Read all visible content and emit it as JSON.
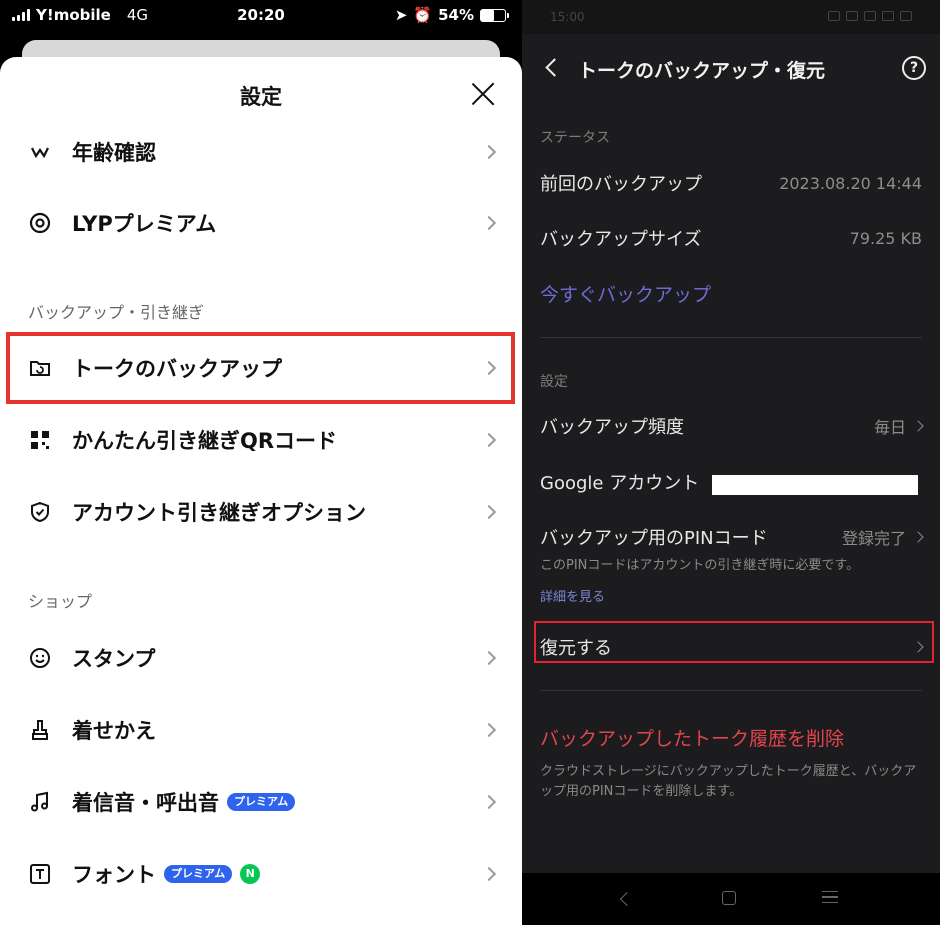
{
  "left": {
    "status": {
      "carrier": "Y!mobile",
      "network": "4G",
      "time": "20:20",
      "battery": "54%",
      "battery_level": 0.54
    },
    "sheet_title": "設定",
    "rows_top": [
      {
        "label": "年齢確認",
        "icon": "id-check-icon"
      },
      {
        "label": "LYPプレミアム",
        "icon": "premium-icon"
      }
    ],
    "section_backup": "バックアップ・引き継ぎ",
    "rows_backup": [
      {
        "label": "トークのバックアップ",
        "icon": "folder-backup-icon"
      },
      {
        "label": "かんたん引き継ぎQRコード",
        "icon": "qr-code-icon"
      },
      {
        "label": "アカウント引き継ぎオプション",
        "icon": "shield-icon"
      }
    ],
    "section_shop": "ショップ",
    "rows_shop": [
      {
        "label": "スタンプ",
        "icon": "smiley-icon"
      },
      {
        "label": "着せかえ",
        "icon": "brush-icon"
      },
      {
        "label": "着信音・呼出音",
        "icon": "music-note-icon",
        "badge": "プレミアム"
      },
      {
        "label": "フォント",
        "icon": "font-icon",
        "badge": "プレミアム",
        "dot": "N"
      }
    ]
  },
  "right": {
    "status_time": "15:00",
    "title": "トークのバックアップ・復元",
    "help_label": "?",
    "section_status": "ステータス",
    "last_backup_label": "前回のバックアップ",
    "last_backup_value": "2023.08.20 14:44",
    "size_label": "バックアップサイズ",
    "size_value": "79.25 KB",
    "backup_now": "今すぐバックアップ",
    "section_settings": "設定",
    "freq_label": "バックアップ頻度",
    "freq_value": "毎日",
    "google_label": "Google アカウント",
    "pin_label": "バックアップ用のPINコード",
    "pin_value": "登録完了",
    "pin_note": "このPINコードはアカウントの引き継ぎ時に必要です。",
    "pin_more": "詳細を見る",
    "restore_label": "復元する",
    "delete_label": "バックアップしたトーク履歴を削除",
    "delete_note": "クラウドストレージにバックアップしたトーク履歴と、バックアップ用のPINコードを削除します。"
  }
}
